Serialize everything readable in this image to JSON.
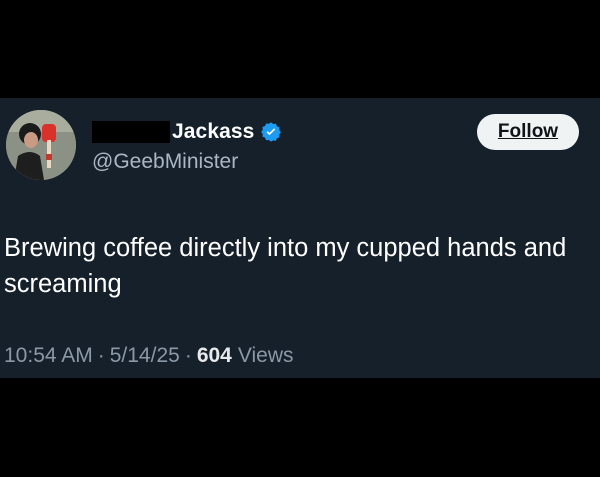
{
  "author": {
    "display_name": "Jackass",
    "handle": "@GeebMinister",
    "verified": true,
    "verified_icon": "verified-badge-icon",
    "verified_color": "#1d9bf0",
    "avatar_icon": "profile-avatar"
  },
  "actions": {
    "follow_label": "Follow"
  },
  "tweet": {
    "text": "Brewing coffee directly into my cupped hands and screaming"
  },
  "meta": {
    "time": "10:54 AM",
    "separator": "·",
    "date": "5/14/25",
    "views_count": "604",
    "views_label": "Views"
  },
  "colors": {
    "background": "#000000",
    "card": "#15202b",
    "text_primary": "#ffffff",
    "text_secondary": "#8b98a5",
    "button_bg": "#eff3f4"
  }
}
